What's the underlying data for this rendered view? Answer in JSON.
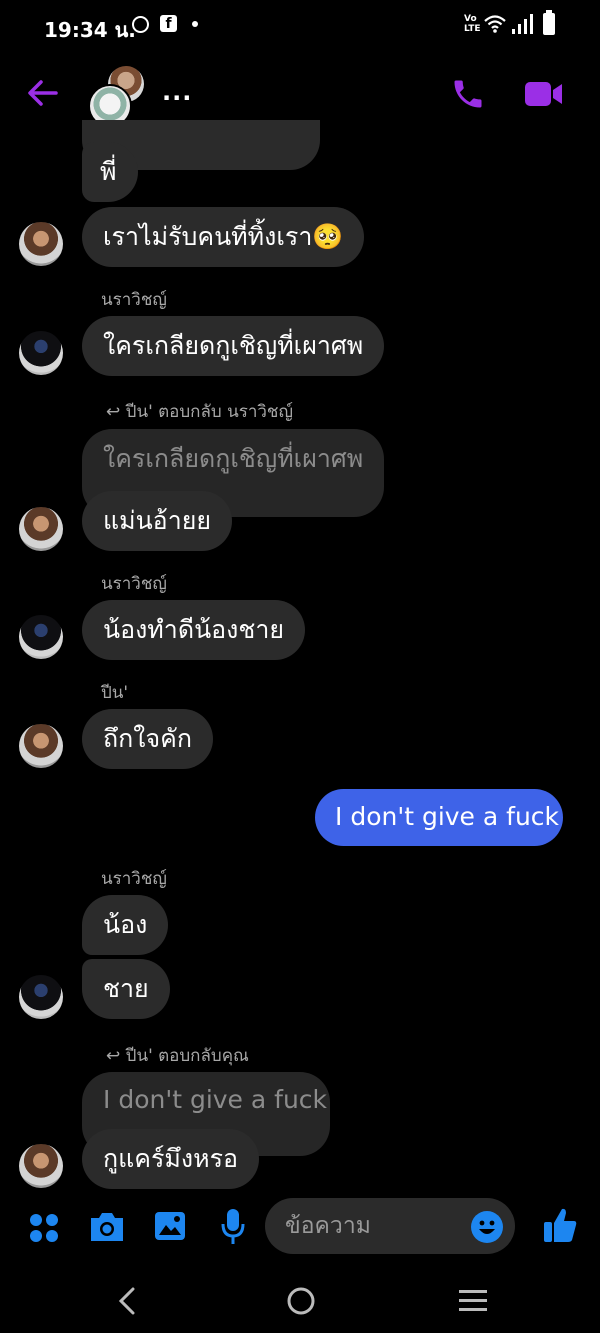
{
  "status_bar": {
    "time": "19:34 น.",
    "network": "VoLTE"
  },
  "header": {
    "title": "...",
    "accent": "#9b2fe6"
  },
  "messages": {
    "partial_top": "พี่",
    "m1": "เราไม่รับคนที่ทิ้งเรา🥺",
    "s1": "นราวิชญ์",
    "m2": "ใครเกลียดกูเชิญที่เผาศพ",
    "r1": "ปีน' ตอบกลับ นราวิชญ์",
    "q1": "ใครเกลียดกูเชิญที่เผาศพ",
    "m3": "แม่นอ้ายย",
    "s2": "นราวิชญ์",
    "m4": "น้องทำดีน้องชาย",
    "s3": "ปีน'",
    "m5": "ถึกใจคัก",
    "me1": "I don't give  a  fuck",
    "s4": "นราวิชญ์",
    "m6": "น้อง",
    "m7": "ชาย",
    "r2": "ปีน' ตอบกลับคุณ",
    "q2": "I don't give  a  fuck",
    "m8": "กูแคร์มึงหรอ"
  },
  "composer": {
    "placeholder": "ข้อความ",
    "icon_color": "#1d86f0"
  },
  "colors": {
    "my_bubble": "#3e63e8",
    "other_bubble": "#2b2b2b"
  }
}
